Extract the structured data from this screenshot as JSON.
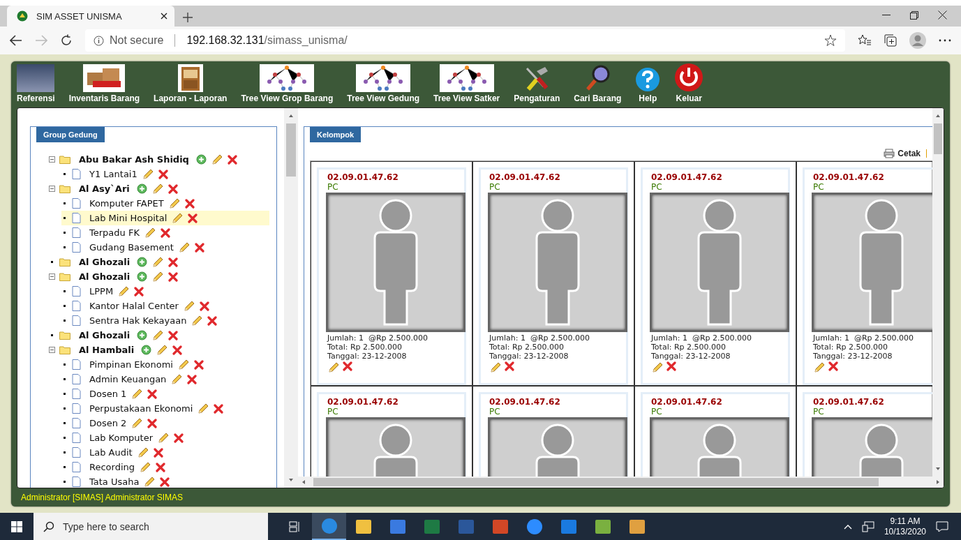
{
  "browser": {
    "tab_title": "SIM ASSET UNISMA",
    "security": "Not secure",
    "url_host": "192.168.32.131",
    "url_path": "/simass_unisma/"
  },
  "toolbar": [
    {
      "label": "Referensi",
      "kind": "photo"
    },
    {
      "label": "Inventaris Barang",
      "kind": "boxes"
    },
    {
      "label": "Laporan - Laporan",
      "kind": "cabinet"
    },
    {
      "label": "Tree View Grop Barang",
      "kind": "tree"
    },
    {
      "label": "Tree View Gedung",
      "kind": "tree"
    },
    {
      "label": "Tree View Satker",
      "kind": "tree"
    },
    {
      "label": "Pengaturan",
      "kind": "tools"
    },
    {
      "label": "Cari Barang",
      "kind": "search"
    },
    {
      "label": "Help",
      "kind": "help"
    },
    {
      "label": "Keluar",
      "kind": "power"
    }
  ],
  "left_panel": {
    "title": "Group Gedung",
    "tree": [
      {
        "label": "Abu Bakar Ash Shidiq",
        "expanded": true,
        "children": [
          {
            "label": "Y1 Lantai1",
            "selected": false
          }
        ]
      },
      {
        "label": "Al Asy`Ari",
        "expanded": true,
        "children": [
          {
            "label": "Komputer FAPET",
            "selected": false
          },
          {
            "label": "Lab Mini Hospital",
            "selected": true
          },
          {
            "label": "Terpadu FK",
            "selected": false
          },
          {
            "label": "Gudang Basement",
            "selected": false
          }
        ]
      },
      {
        "label": "Al Ghozali",
        "expanded": false
      },
      {
        "label": "Al Ghozali",
        "expanded": true,
        "children": [
          {
            "label": "LPPM",
            "selected": false
          },
          {
            "label": "Kantor Halal Center",
            "selected": false
          },
          {
            "label": "Sentra Hak Kekayaan",
            "selected": false
          }
        ]
      },
      {
        "label": "Al Ghozali",
        "expanded": false
      },
      {
        "label": "Al Hambali",
        "expanded": true,
        "children": [
          {
            "label": "Pimpinan Ekonomi",
            "selected": false
          },
          {
            "label": "Admin Keuangan",
            "selected": false
          },
          {
            "label": "Dosen 1",
            "selected": false
          },
          {
            "label": "Perpustakaan Ekonomi",
            "selected": false
          },
          {
            "label": "Dosen 2",
            "selected": false
          },
          {
            "label": "Lab Komputer",
            "selected": false
          },
          {
            "label": "Lab Audit",
            "selected": false
          },
          {
            "label": "Recording",
            "selected": false
          },
          {
            "label": "Tata Usaha",
            "selected": false
          }
        ]
      }
    ]
  },
  "right_panel": {
    "title": "Kelompok",
    "print_link": "Cetak",
    "cards": [
      {
        "code": "02.09.01.47.62",
        "type": "PC",
        "quantity": "Jumlah: 1  @Rp 2.500.000",
        "total": "Total: Rp 2.500.000",
        "date": "Tanggal: 23-12-2008"
      },
      {
        "code": "02.09.01.47.62",
        "type": "PC",
        "quantity": "Jumlah: 1  @Rp 2.500.000",
        "total": "Total: Rp 2.500.000",
        "date": "Tanggal: 23-12-2008"
      },
      {
        "code": "02.09.01.47.62",
        "type": "PC",
        "quantity": "Jumlah: 1  @Rp 2.500.000",
        "total": "Total: Rp 2.500.000",
        "date": "Tanggal: 23-12-2008"
      },
      {
        "code": "02.09.01.47.62",
        "type": "PC",
        "quantity": "Jumlah: 1  @Rp 2.500.000",
        "total": "Total: Rp 2.500.000",
        "date": "Tanggal: 23-12-2008"
      },
      {
        "code": "02.09.01.47.62",
        "type": "PC"
      },
      {
        "code": "02.09.01.47.62",
        "type": "PC"
      },
      {
        "code": "02.09.01.47.62",
        "type": "PC"
      },
      {
        "code": "02.09.01.47.62",
        "type": "PC"
      }
    ]
  },
  "status_bar": "Administrator [SIMAS] Administrator SIMAS",
  "taskbar": {
    "search_placeholder": "Type here to search",
    "apps": [
      {
        "kind": "task-view",
        "selected": false
      },
      {
        "kind": "browser",
        "selected": true
      },
      {
        "kind": "folder",
        "selected": false
      },
      {
        "kind": "store",
        "selected": false
      },
      {
        "kind": "excel",
        "selected": false
      },
      {
        "kind": "word",
        "selected": false
      },
      {
        "kind": "powerpoint",
        "selected": false
      },
      {
        "kind": "video",
        "selected": false
      },
      {
        "kind": "mail",
        "selected": false
      },
      {
        "kind": "chart",
        "selected": false
      },
      {
        "kind": "paint",
        "selected": false
      }
    ],
    "time": "9:11 AM",
    "date": "10/13/2020"
  }
}
